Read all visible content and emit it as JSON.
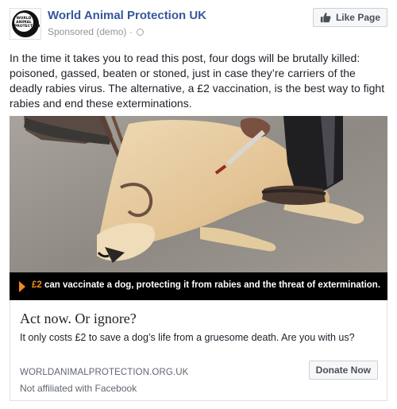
{
  "header": {
    "page_name": "World Animal Protection UK",
    "sponsored": "Sponsored (demo)",
    "separator": "·",
    "like_button": "Like Page",
    "avatar_text": "WORLD ANIMAL PROTECTION"
  },
  "post": {
    "body": "In the time it takes you to read this post, four dogs will be brutally killed: poisoned, gassed, beaten or stoned, just in case they’re carriers of the deadly rabies virus. The alternative, a £2 vaccination, is the best way to fight rabies and end these exterminations."
  },
  "media": {
    "banner_highlight": "£2",
    "banner_text": "can vaccinate a dog, protecting it from rabies and the threat of extermination."
  },
  "link": {
    "headline": "Act now. Or ignore?",
    "description": "It only costs £2 to save a dog’s life from a gruesome death. Are you with us?",
    "domain": "WORLDANIMALPROTECTION.ORG.UK",
    "affiliation": "Not affiliated with Facebook",
    "cta_button": "Donate Now"
  },
  "colors": {
    "link_blue": "#365899",
    "accent_orange": "#f08a24",
    "meta_gray": "#90949c"
  }
}
